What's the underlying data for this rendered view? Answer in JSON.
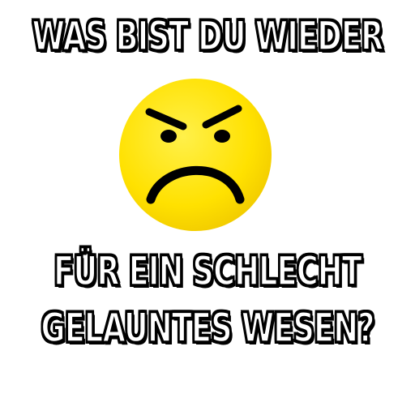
{
  "caption": {
    "top": "WAS BIST DU WIEDER",
    "bottom_line_1": "FÜR EIN SCHLECHT",
    "bottom_line_2": "GELAUNTES WESEN?"
  },
  "emoji": {
    "icon": "angry-face-icon",
    "face_color": "#FFE600",
    "feature_color": "#000000"
  },
  "colors": {
    "background": "#FFFFFF",
    "text_fill": "#FFFFFF",
    "text_outline": "#000000"
  }
}
